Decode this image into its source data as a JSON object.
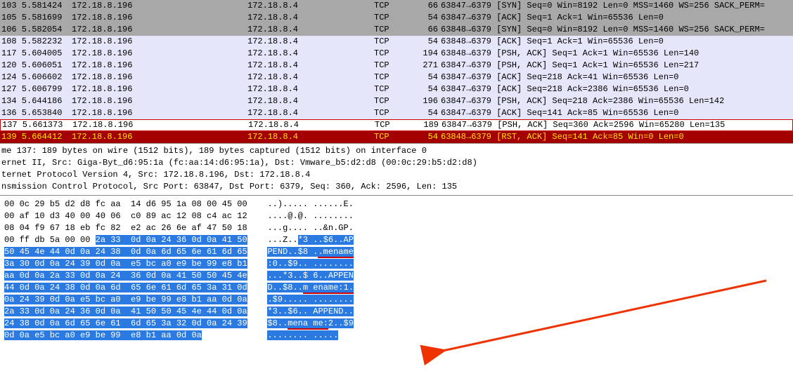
{
  "packets": [
    {
      "no": "103",
      "time": "5.581424",
      "src": "172.18.8.196",
      "dst": "172.18.8.4",
      "prot": "TCP",
      "len": "66",
      "info": "63847→6379 [SYN] Seq=0 Win=8192 Len=0 MSS=1460 WS=256 SACK_PERM=",
      "style": "gray"
    },
    {
      "no": "105",
      "time": "5.581699",
      "src": "172.18.8.196",
      "dst": "172.18.8.4",
      "prot": "TCP",
      "len": "54",
      "info": "63847→6379 [ACK] Seq=1 Ack=1 Win=65536 Len=0",
      "style": "gray"
    },
    {
      "no": "106",
      "time": "5.582054",
      "src": "172.18.8.196",
      "dst": "172.18.8.4",
      "prot": "TCP",
      "len": "66",
      "info": "63848→6379 [SYN] Seq=0 Win=8192 Len=0 MSS=1460 WS=256 SACK_PERM=",
      "style": "gray"
    },
    {
      "no": "108",
      "time": "5.582232",
      "src": "172.18.8.196",
      "dst": "172.18.8.4",
      "prot": "TCP",
      "len": "54",
      "info": "63848→6379 [ACK] Seq=1 Ack=1 Win=65536 Len=0",
      "style": "lav"
    },
    {
      "no": "117",
      "time": "5.604005",
      "src": "172.18.8.196",
      "dst": "172.18.8.4",
      "prot": "TCP",
      "len": "194",
      "info": "63848→6379 [PSH, ACK] Seq=1 Ack=1 Win=65536 Len=140",
      "style": "lav"
    },
    {
      "no": "120",
      "time": "5.606051",
      "src": "172.18.8.196",
      "dst": "172.18.8.4",
      "prot": "TCP",
      "len": "271",
      "info": "63847→6379 [PSH, ACK] Seq=1 Ack=1 Win=65536 Len=217",
      "style": "lav"
    },
    {
      "no": "124",
      "time": "5.606602",
      "src": "172.18.8.196",
      "dst": "172.18.8.4",
      "prot": "TCP",
      "len": "54",
      "info": "63847→6379 [ACK] Seq=218 Ack=41 Win=65536 Len=0",
      "style": "lav"
    },
    {
      "no": "127",
      "time": "5.606799",
      "src": "172.18.8.196",
      "dst": "172.18.8.4",
      "prot": "TCP",
      "len": "54",
      "info": "63847→6379 [ACK] Seq=218 Ack=2386 Win=65536 Len=0",
      "style": "lav"
    },
    {
      "no": "134",
      "time": "5.644186",
      "src": "172.18.8.196",
      "dst": "172.18.8.4",
      "prot": "TCP",
      "len": "196",
      "info": "63847→6379 [PSH, ACK] Seq=218 Ack=2386 Win=65536 Len=142",
      "style": "lav"
    },
    {
      "no": "136",
      "time": "5.653840",
      "src": "172.18.8.196",
      "dst": "172.18.8.4",
      "prot": "TCP",
      "len": "54",
      "info": "63847→6379 [ACK] Seq=141 Ack=85 Win=65536 Len=0",
      "style": "lav"
    },
    {
      "no": "137",
      "time": "5.661373",
      "src": "172.18.8.196",
      "dst": "172.18.8.4",
      "prot": "TCP",
      "len": "189",
      "info": "63847→6379 [PSH, ACK] Seq=360 Ack=2596 Win=65280 Len=135",
      "style": "sel"
    },
    {
      "no": "139",
      "time": "5.664412",
      "src": "172.18.8.196",
      "dst": "172.18.8.4",
      "prot": "TCP",
      "len": "54",
      "info": "63848→6379 [RST, ACK] Seq=141 Ack=85 Win=0 Len=0",
      "style": "red"
    }
  ],
  "details": {
    "l1": "me 137: 189 bytes on wire (1512 bits), 189 bytes captured (1512 bits) on interface 0",
    "l2": "ernet II, Src: Giga-Byt_d6:95:1a (fc:aa:14:d6:95:1a), Dst: Vmware_b5:d2:d8 (00:0c:29:b5:d2:d8)",
    "l3": "ternet Protocol Version 4, Src: 172.18.8.196, Dst: 172.18.8.4",
    "l4": "nsmission Control Protocol, Src Port: 63847, Dst Port: 6379, Seq: 360, Ack: 2596, Len: 135"
  },
  "hex": {
    "rows": [
      {
        "p": "00 0c 29 b5 d2 d8 fc aa  14 d6 95 1a 08 00 45 00",
        "s": "",
        "a": "..)..... ......E.",
        "as": ""
      },
      {
        "p": "00 af 10 d3 40 00 40 06  c0 89 ac 12 08 c4 ac 12",
        "s": "",
        "a": "....@.@. ........",
        "as": ""
      },
      {
        "p": "08 04 f9 67 18 eb fc 82  e2 ac 26 6e af 47 50 18",
        "s": "",
        "a": "...g.... ..&n.GP.",
        "as": ""
      },
      {
        "p": "00 ff db 5a 00 00 ",
        "s": "2a 33  0d 0a 24 36 0d 0a 41 50",
        "a": "...Z..",
        "as": "*3 ..$6..AP"
      },
      {
        "p": "",
        "s": "50 45 4e 44 0d 0a 24 38  0d 0a 6d 65 6e 61 6d 65",
        "a": "",
        "as": "PEND..$8 ..mename",
        "u": [
          10,
          17
        ]
      },
      {
        "p": "",
        "s": "3a 30 0d 0a 24 39 0d 0a  e5 bc a0 e9 be 99 e8 b1",
        "a": "",
        "as": ":0..$9.. ........"
      },
      {
        "p": "",
        "s": "aa 0d 0a 2a 33 0d 0a 24  36 0d 0a 41 50 50 45 4e",
        "a": "",
        "as": "...*3..$ 6..APPEN"
      },
      {
        "p": "",
        "s": "44 0d 0a 24 38 0d 0a 6d  65 6e 61 6d 65 3a 31 0d",
        "a": "",
        "as": "D..$8..m ename:1.",
        "u": [
          7,
          17
        ]
      },
      {
        "p": "",
        "s": "0a 24 39 0d 0a e5 bc a0  e9 be 99 e8 b1 aa 0d 0a",
        "a": "",
        "as": ".$9..... ........"
      },
      {
        "p": "",
        "s": "2a 33 0d 0a 24 36 0d 0a  41 50 50 45 4e 44 0d 0a",
        "a": "",
        "as": "*3..$6.. APPEND.."
      },
      {
        "p": "",
        "s": "24 38 0d 0a 6d 65 6e 61  6d 65 3a 32 0d 0a 24 39",
        "a": "",
        "as": "$8..mena me:2..$9",
        "u": [
          4,
          12
        ]
      },
      {
        "p": "",
        "s": "0d 0a e5 bc a0 e9 be 99  e8 b1 aa 0d 0a",
        "a": "",
        "as": "........ ....."
      }
    ]
  }
}
